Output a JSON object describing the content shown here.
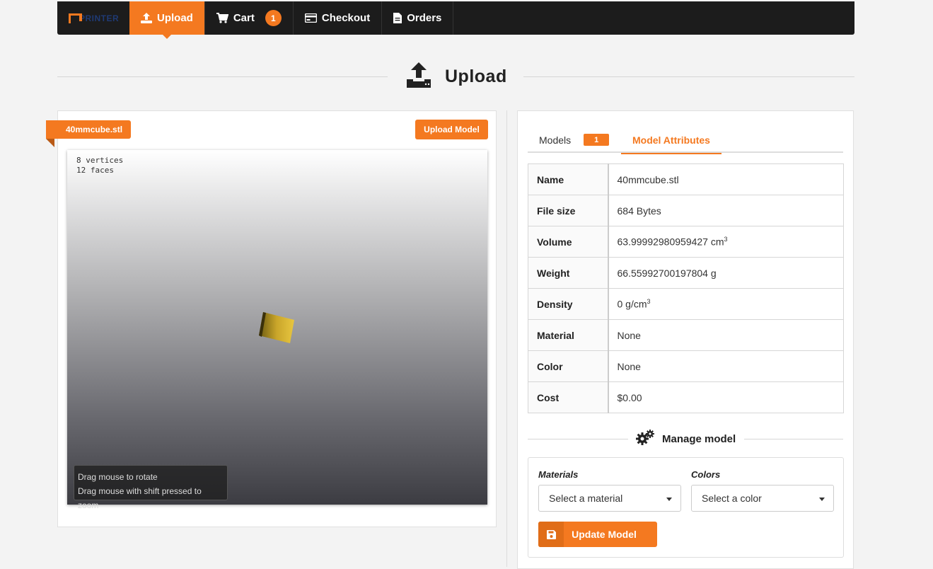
{
  "navbar": {
    "brand": "PRINTER",
    "items": [
      {
        "label": "Upload",
        "icon": "upload-icon",
        "active": true
      },
      {
        "label": "Cart",
        "icon": "cart-icon",
        "badge": "1"
      },
      {
        "label": "Checkout",
        "icon": "credit-card-icon"
      },
      {
        "label": "Orders",
        "icon": "document-icon"
      }
    ]
  },
  "page": {
    "title": "Upload",
    "title_icon": "upload-tray-icon"
  },
  "viewer": {
    "file_name": "40mmcube.stl",
    "upload_button": "Upload Model",
    "stats": [
      "8 vertices",
      "12 faces"
    ],
    "help": [
      "Drag mouse to rotate",
      "Drag mouse with shift pressed to zoom"
    ]
  },
  "tabs": [
    {
      "label": "Models",
      "badge": "1"
    },
    {
      "label": "Model Attributes",
      "active": true
    }
  ],
  "attributes": [
    {
      "key": "Name",
      "value": "40mmcube.stl"
    },
    {
      "key": "File size",
      "value": "684 Bytes"
    },
    {
      "key": "Volume",
      "value": "63.99992980959427 cm",
      "sup": "3"
    },
    {
      "key": "Weight",
      "value": "66.55992700197804 g"
    },
    {
      "key": "Density",
      "value": "0 g/cm",
      "sup": "3"
    },
    {
      "key": "Material",
      "value": "None"
    },
    {
      "key": "Color",
      "value": "None"
    },
    {
      "key": "Cost",
      "value": "$0.00"
    }
  ],
  "manage": {
    "title": "Manage model",
    "materials_label": "Materials",
    "materials_placeholder": "Select a material",
    "colors_label": "Colors",
    "colors_placeholder": "Select a color",
    "update_button": "Update Model"
  },
  "colors": {
    "accent": "#f47920",
    "navbar": "#1c1c1c"
  }
}
